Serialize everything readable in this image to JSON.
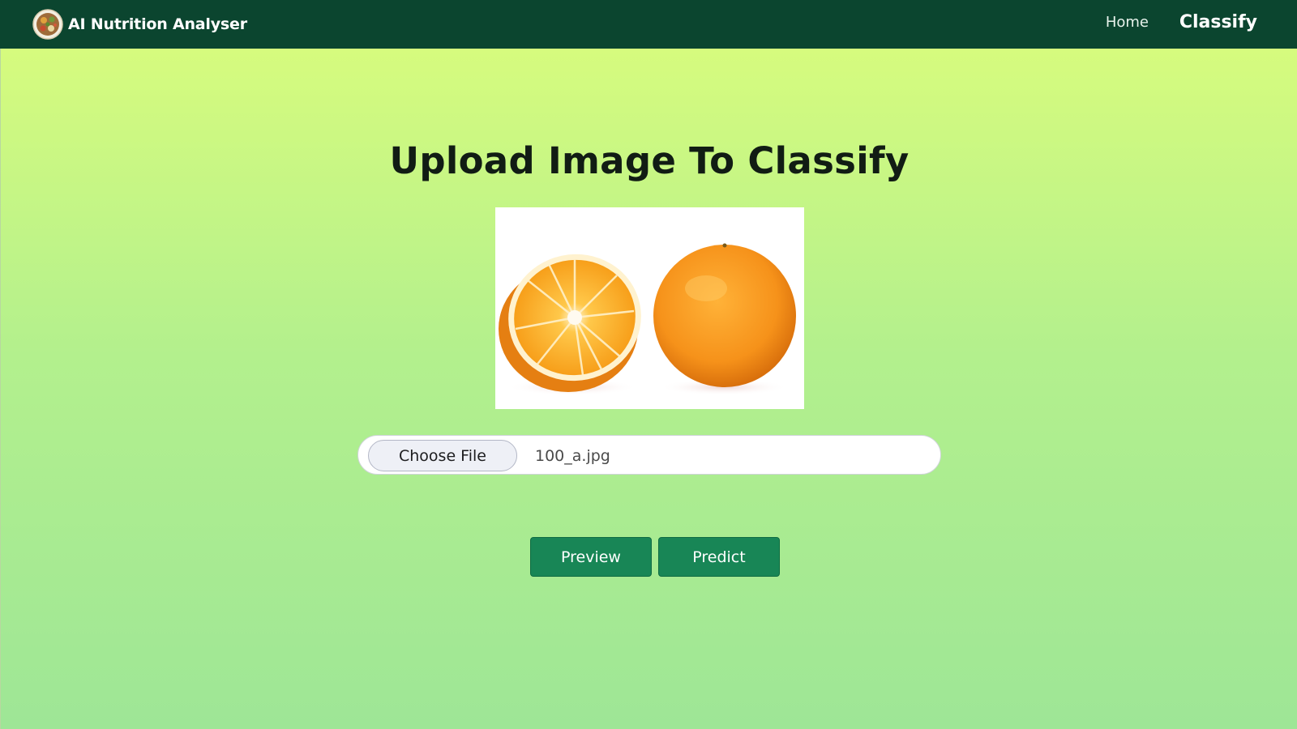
{
  "navbar": {
    "brand_title": "AI Nutrition Analyser",
    "logo_icon": "salad-bowl-icon",
    "links": [
      {
        "label": "Home",
        "active": false
      },
      {
        "label": "Classify",
        "active": true
      }
    ],
    "background_color": "#0b452f"
  },
  "main": {
    "heading": "Upload Image To Classify",
    "preview_image": {
      "subject": "orange-halves-photo"
    },
    "file_input": {
      "button_label": "Choose File",
      "selected_file": "100_a.jpg"
    },
    "actions": {
      "preview_label": "Preview",
      "predict_label": "Predict"
    },
    "gradient_colors": [
      "#d6fb7e",
      "#9ee696"
    ],
    "accent_color": "#188656"
  }
}
